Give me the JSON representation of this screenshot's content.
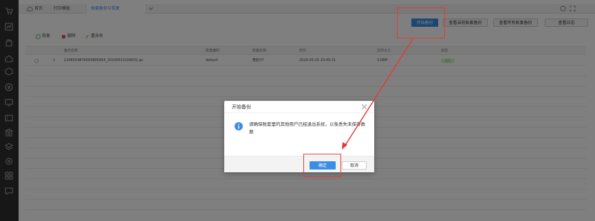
{
  "tabs": {
    "home": "首页",
    "print_template": "打印模板",
    "active_tab": "账套备份与恢复"
  },
  "top_buttons": {
    "start_backup": "开始备份",
    "view_current": "查看当前账套备份",
    "view_all": "查看所有账套备份",
    "view_log": "查看日志"
  },
  "toolbar": {
    "restore": "恢复",
    "delete": "删除",
    "rename": "重命名"
  },
  "table": {
    "headers": [
      "备份名称",
      "账套编码",
      "账套名称",
      "时间",
      "文件大小",
      "状态"
    ],
    "rows": [
      {
        "index": "1",
        "name": "120655487458380595​4_20200515104031.gz",
        "code": "default",
        "account_name": "麦妃V7",
        "time": "2020-05-15 10:40:31",
        "size": "3.06M",
        "status": "成功"
      }
    ]
  },
  "dialog": {
    "title": "开始备份",
    "message": "请确保账套里的其他用户已经退出系统，以免丢失未保存数据",
    "ok": "确定",
    "cancel": "取消"
  },
  "colors": {
    "primary": "#3a8ee6",
    "sidebar": "#2e2e2e",
    "annotation": "#e53935"
  }
}
